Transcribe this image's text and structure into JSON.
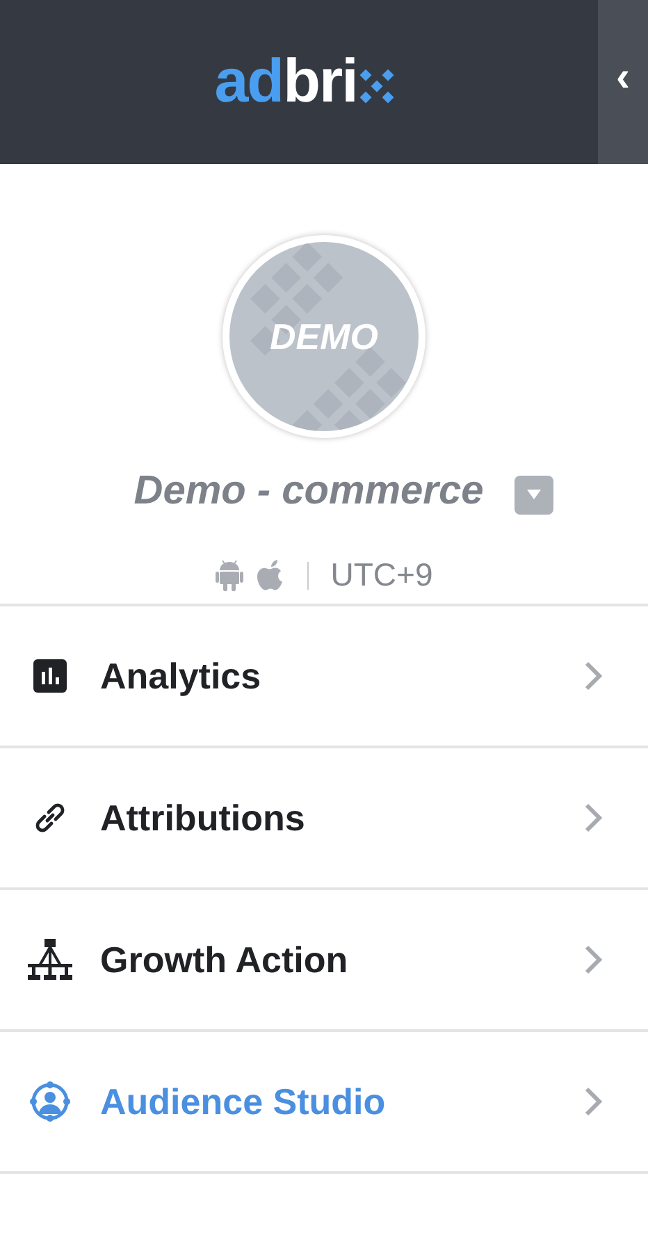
{
  "header": {
    "logo": [
      {
        "text": "ad",
        "kind": "accent"
      },
      {
        "text": "bri",
        "kind": "plain"
      }
    ],
    "collapse_button": "‹"
  },
  "project": {
    "avatar_label": "DEMO",
    "name": "Demo - commerce",
    "timezone": "UTC+9"
  },
  "menu": [
    {
      "label": "Analytics",
      "kind": "chart",
      "selected": false
    },
    {
      "label": "Attributions",
      "kind": "link",
      "selected": false
    },
    {
      "label": "Growth Action",
      "kind": "tree",
      "selected": false
    },
    {
      "label": "Audience Studio",
      "kind": "audience",
      "selected": true
    }
  ]
}
